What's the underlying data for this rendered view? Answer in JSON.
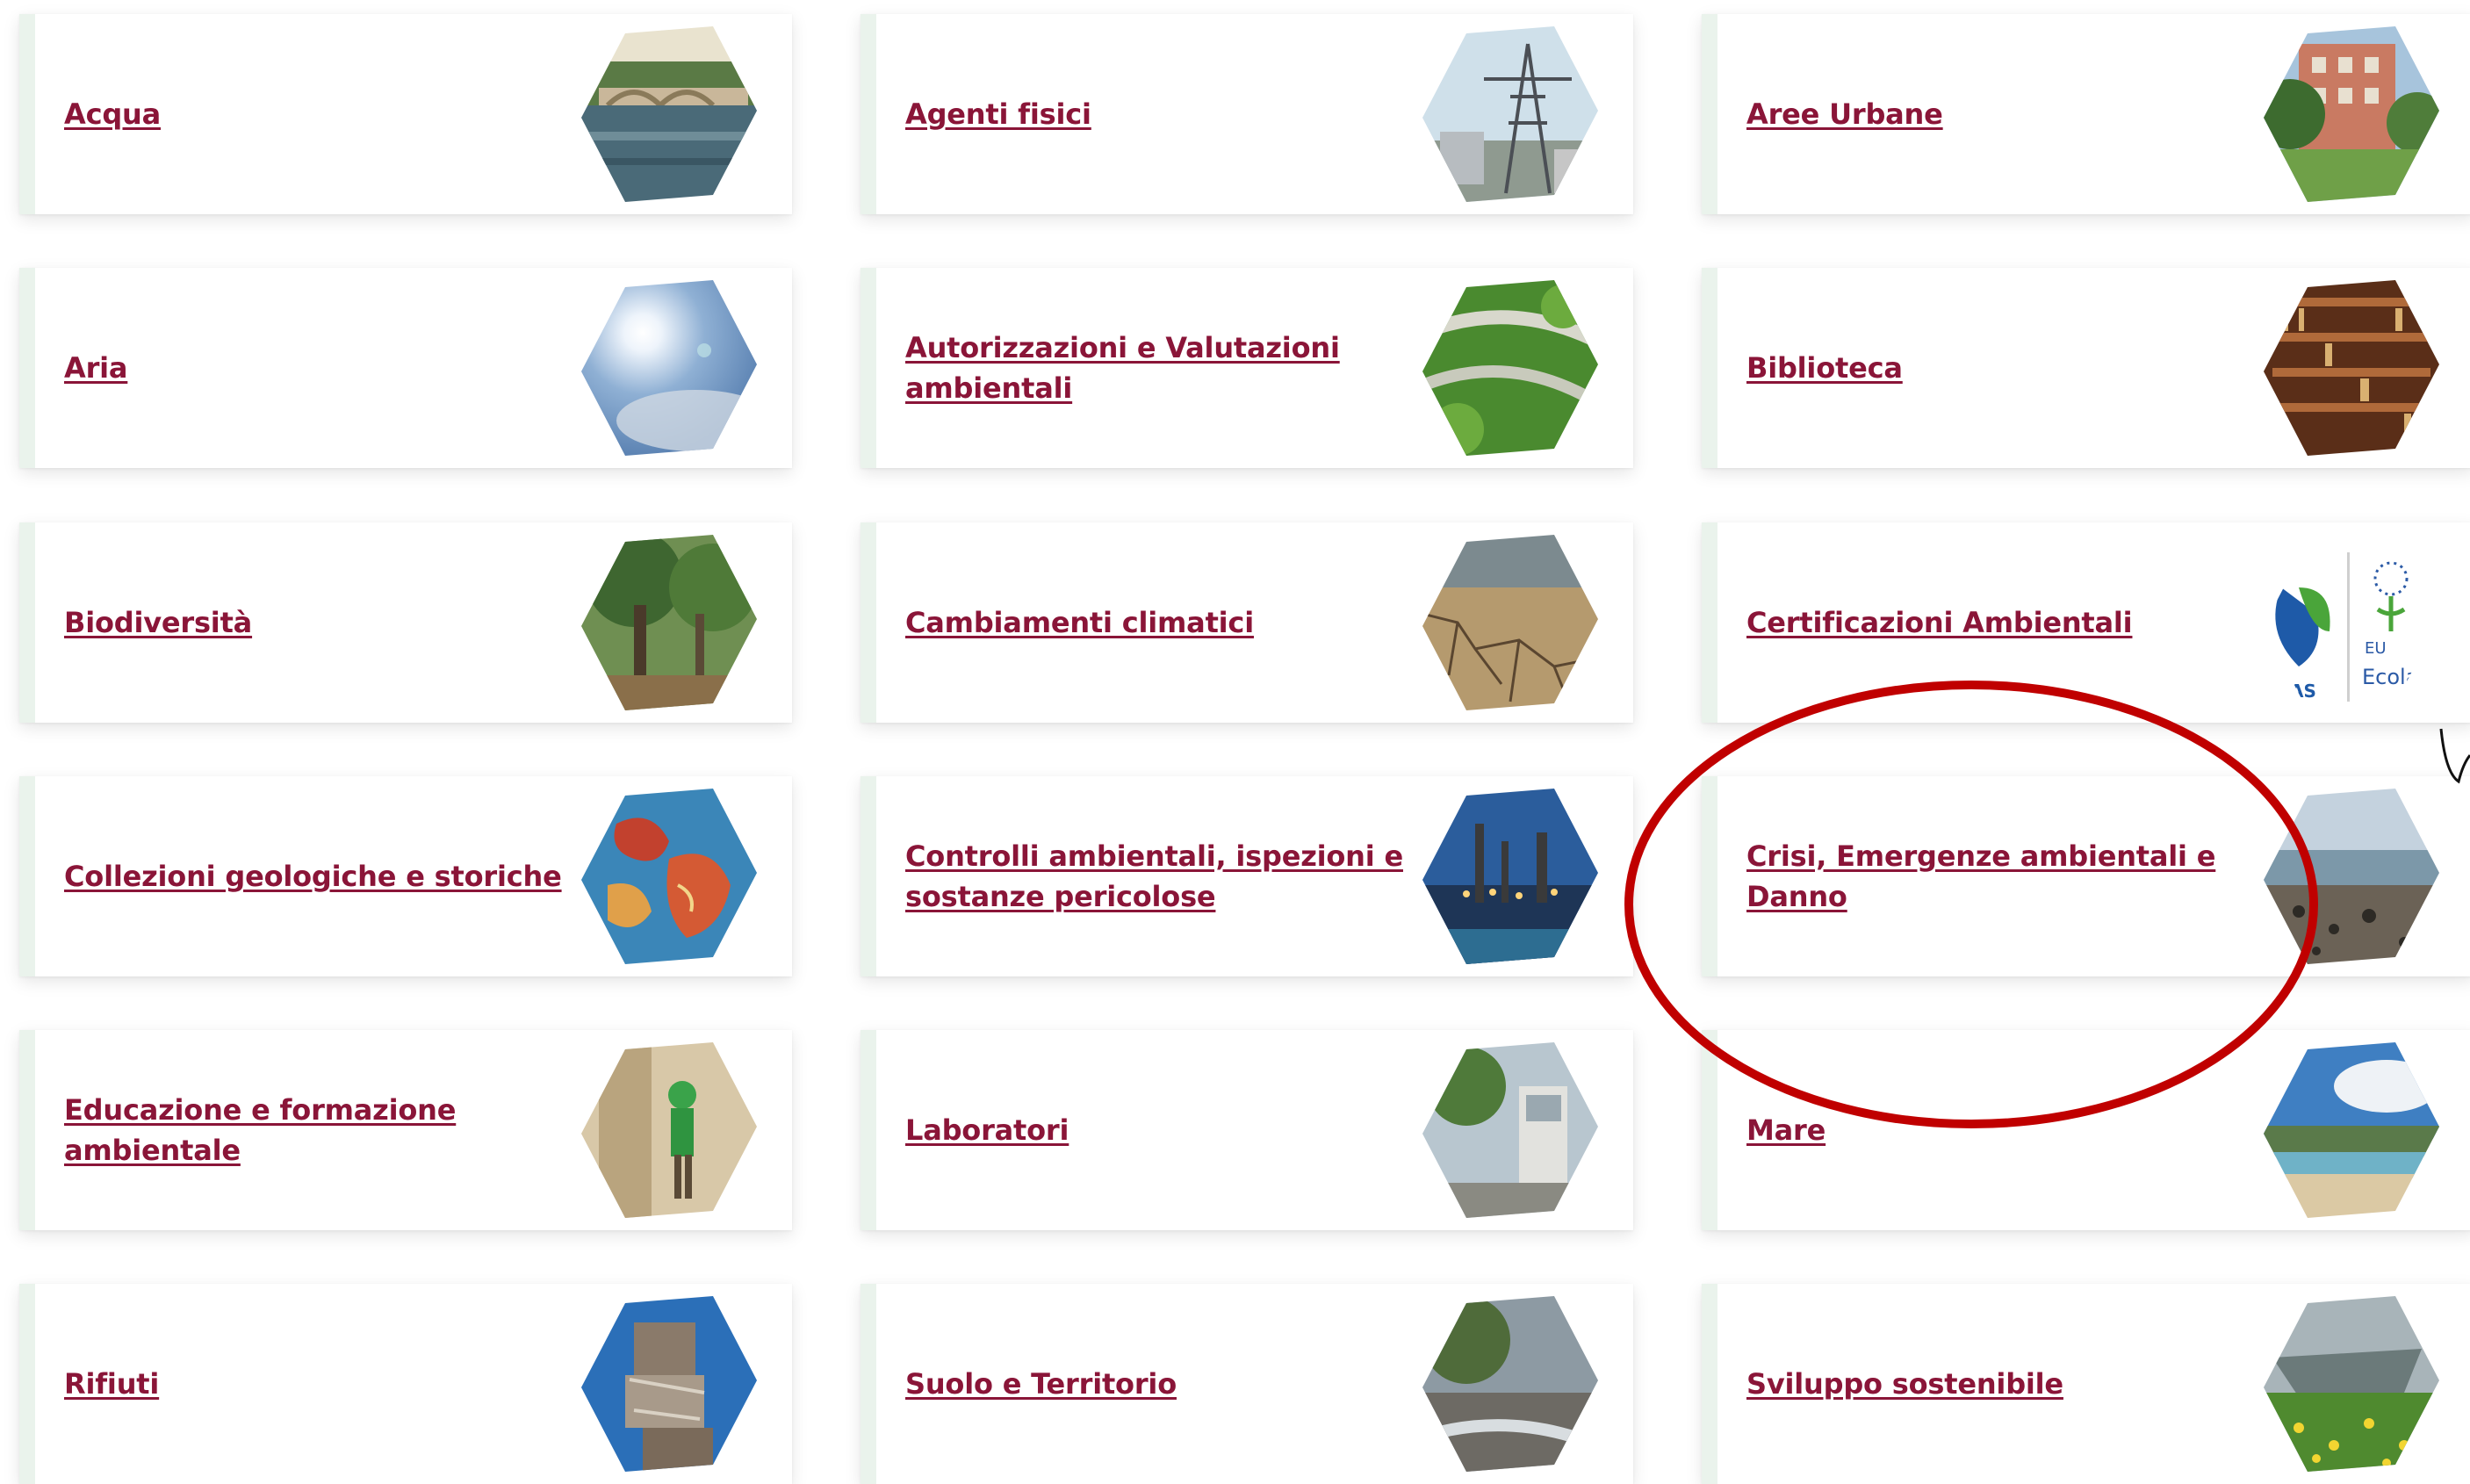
{
  "topics": [
    {
      "label": "Acqua",
      "image": "river-bridge-thumbnail"
    },
    {
      "label": "Agenti fisici",
      "image": "power-pylon-thumbnail"
    },
    {
      "label": "Aree Urbane",
      "image": "urban-park-thumbnail"
    },
    {
      "label": "Aria",
      "image": "sun-sky-thumbnail"
    },
    {
      "label": "Autorizzazioni e Valutazioni ambientali",
      "image": "highway-greenery-thumbnail"
    },
    {
      "label": "Biblioteca",
      "image": "library-shelves-thumbnail"
    },
    {
      "label": "Biodiversità",
      "image": "forest-thumbnail"
    },
    {
      "label": "Cambiamenti climatici",
      "image": "cracked-ground-thumbnail"
    },
    {
      "label": "Certificazioni Ambientali",
      "image": "ecolabel-logo-thumbnail"
    },
    {
      "label": "Collezioni geologiche e storiche",
      "image": "relief-map-thumbnail"
    },
    {
      "label": "Controlli ambientali, ispezioni e sostanze pericolose",
      "image": "refinery-thumbnail"
    },
    {
      "label": "Crisi, Emergenze ambientali e Danno",
      "image": "oil-beach-thumbnail"
    },
    {
      "label": "Educazione e formazione ambientale",
      "image": "child-outdoor-thumbnail"
    },
    {
      "label": "Laboratori",
      "image": "monitoring-station-thumbnail"
    },
    {
      "label": "Mare",
      "image": "sea-coast-thumbnail"
    },
    {
      "label": "Rifiuti",
      "image": "waste-bales-thumbnail"
    },
    {
      "label": "Suolo e Territorio",
      "image": "landslide-river-thumbnail"
    },
    {
      "label": "Sviluppo sostenibile",
      "image": "boat-meadow-thumbnail"
    }
  ],
  "logo_text": {
    "top": "EU",
    "bottom": "Ecolabel",
    "left": "AS"
  },
  "colors": {
    "link": "#8a1538",
    "card_accent": "#eaf3ec",
    "annotation": "#c00000"
  }
}
